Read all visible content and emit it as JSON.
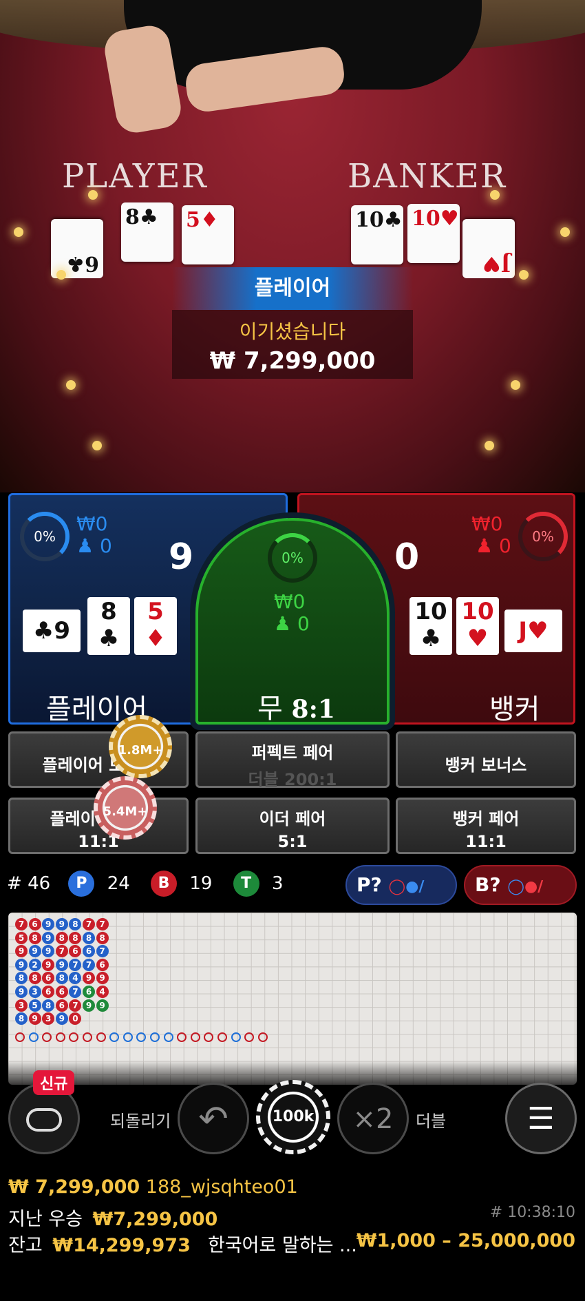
{
  "video": {
    "player_label": "PLAYER",
    "banker_label": "BANKER",
    "player_cards": [
      {
        "rank": "6",
        "suit": "♣",
        "red": false
      },
      {
        "rank": "8",
        "suit": "♣",
        "red": false
      },
      {
        "rank": "5",
        "suit": "♦",
        "red": true
      }
    ],
    "banker_cards": [
      {
        "rank": "10",
        "suit": "♣",
        "red": false
      },
      {
        "rank": "10",
        "suit": "♥",
        "red": true
      },
      {
        "rank": "J",
        "suit": "♥",
        "red": true
      }
    ],
    "result_banner": "플레이어",
    "win_label": "이기셨습니다",
    "win_amount": "₩ 7,299,000"
  },
  "bets": {
    "player": {
      "percent": "0%",
      "amount": "₩0",
      "players": "0",
      "score": "9",
      "title": "플레이어",
      "cards": [
        {
          "rank": "9",
          "suit": "♣",
          "red": false,
          "side": true
        },
        {
          "rank": "8",
          "suit": "♣",
          "red": false,
          "side": false
        },
        {
          "rank": "5",
          "suit": "♦",
          "red": true,
          "side": false
        }
      ]
    },
    "tie": {
      "percent": "0%",
      "amount": "₩0",
      "players": "0",
      "title": "무",
      "payout": "8:1"
    },
    "banker": {
      "percent": "0%",
      "amount": "₩0",
      "players": "0",
      "score": "0",
      "title": "뱅커",
      "cards": [
        {
          "rank": "10",
          "suit": "♣",
          "red": false,
          "side": false
        },
        {
          "rank": "10",
          "suit": "♥",
          "red": true,
          "side": false
        },
        {
          "rank": "J",
          "suit": "♥",
          "red": true,
          "side": true
        }
      ]
    }
  },
  "side_bets": {
    "player_bonus": "플레이어 보너스",
    "perfect_pair": "퍼펙트 페어",
    "perfect_pair_payout": "더블 200:1",
    "banker_bonus": "뱅커 보너스",
    "player_pair": "플레이어 페어",
    "player_pair_payout": "11:1",
    "either_pair": "이더 페어",
    "either_pair_payout": "5:1",
    "banker_pair": "뱅커 페어",
    "banker_pair_payout": "11:1"
  },
  "chips_on_table": {
    "player_bonus_chip": "1.8M+",
    "player_pair_chip": "5.4M+"
  },
  "stats": {
    "hash_label": "#",
    "rounds": "46",
    "p_badge": "P",
    "p_count": "24",
    "b_badge": "B",
    "b_count": "19",
    "t_badge": "T",
    "t_count": "3",
    "player_predict": "P?",
    "banker_predict": "B?"
  },
  "roadmap": {
    "bead_columns": [
      [
        "7",
        "6",
        "9",
        "9",
        "8",
        "7",
        "7"
      ],
      [
        "5",
        "8",
        "9",
        "8",
        "8",
        "8",
        "8"
      ],
      [
        "9",
        "9",
        "9",
        "7",
        "6",
        "6",
        "7"
      ],
      [
        "9",
        "2",
        "9",
        "9",
        "7",
        "7",
        "6"
      ],
      [
        "8",
        "8",
        "6",
        "8",
        "4",
        "9",
        "9"
      ],
      [
        "9",
        "3",
        "6",
        "6",
        "7",
        "6",
        "4"
      ],
      [
        "3",
        "5",
        "8",
        "6",
        "7",
        "9",
        "9"
      ],
      [
        "8",
        "9",
        "3",
        "9",
        "0",
        ""
      ]
    ],
    "bead_colors": [
      [
        "r",
        "r",
        "b",
        "b",
        "b",
        "r",
        "r"
      ],
      [
        "r",
        "r",
        "b",
        "r",
        "r",
        "b",
        "r"
      ],
      [
        "r",
        "b",
        "b",
        "r",
        "r",
        "b",
        "b"
      ],
      [
        "b",
        "b",
        "r",
        "b",
        "b",
        "b",
        "r"
      ],
      [
        "b",
        "r",
        "r",
        "b",
        "b",
        "r",
        "r"
      ],
      [
        "b",
        "b",
        "r",
        "r",
        "b",
        "g",
        "r"
      ],
      [
        "r",
        "b",
        "b",
        "r",
        "r",
        "g",
        "g"
      ],
      [
        "b",
        "r",
        "r",
        "b",
        "r",
        ""
      ]
    ]
  },
  "controls": {
    "new_badge": "신규",
    "undo_label": "되돌리기",
    "chip_value": "100k",
    "double_symbol": "×2",
    "double_label": "더블"
  },
  "footer": {
    "last_win_amount": "₩ 7,299,000",
    "username": "188_wjsqhteo01",
    "prev_win_label": "지난 우승",
    "prev_win_amount": "₩7,299,000",
    "round_id": "# 10:38:10",
    "balance_label": "잔고",
    "balance_amount": "₩14,299,973",
    "table_name": "한국어로 말하는 ...",
    "limits": "₩1,000 – 25,000,000"
  },
  "colors": {
    "player_blue": "#1f6de0",
    "banker_red": "#c2141f",
    "tie_green": "#27b12c",
    "gold": "#f6c445"
  }
}
